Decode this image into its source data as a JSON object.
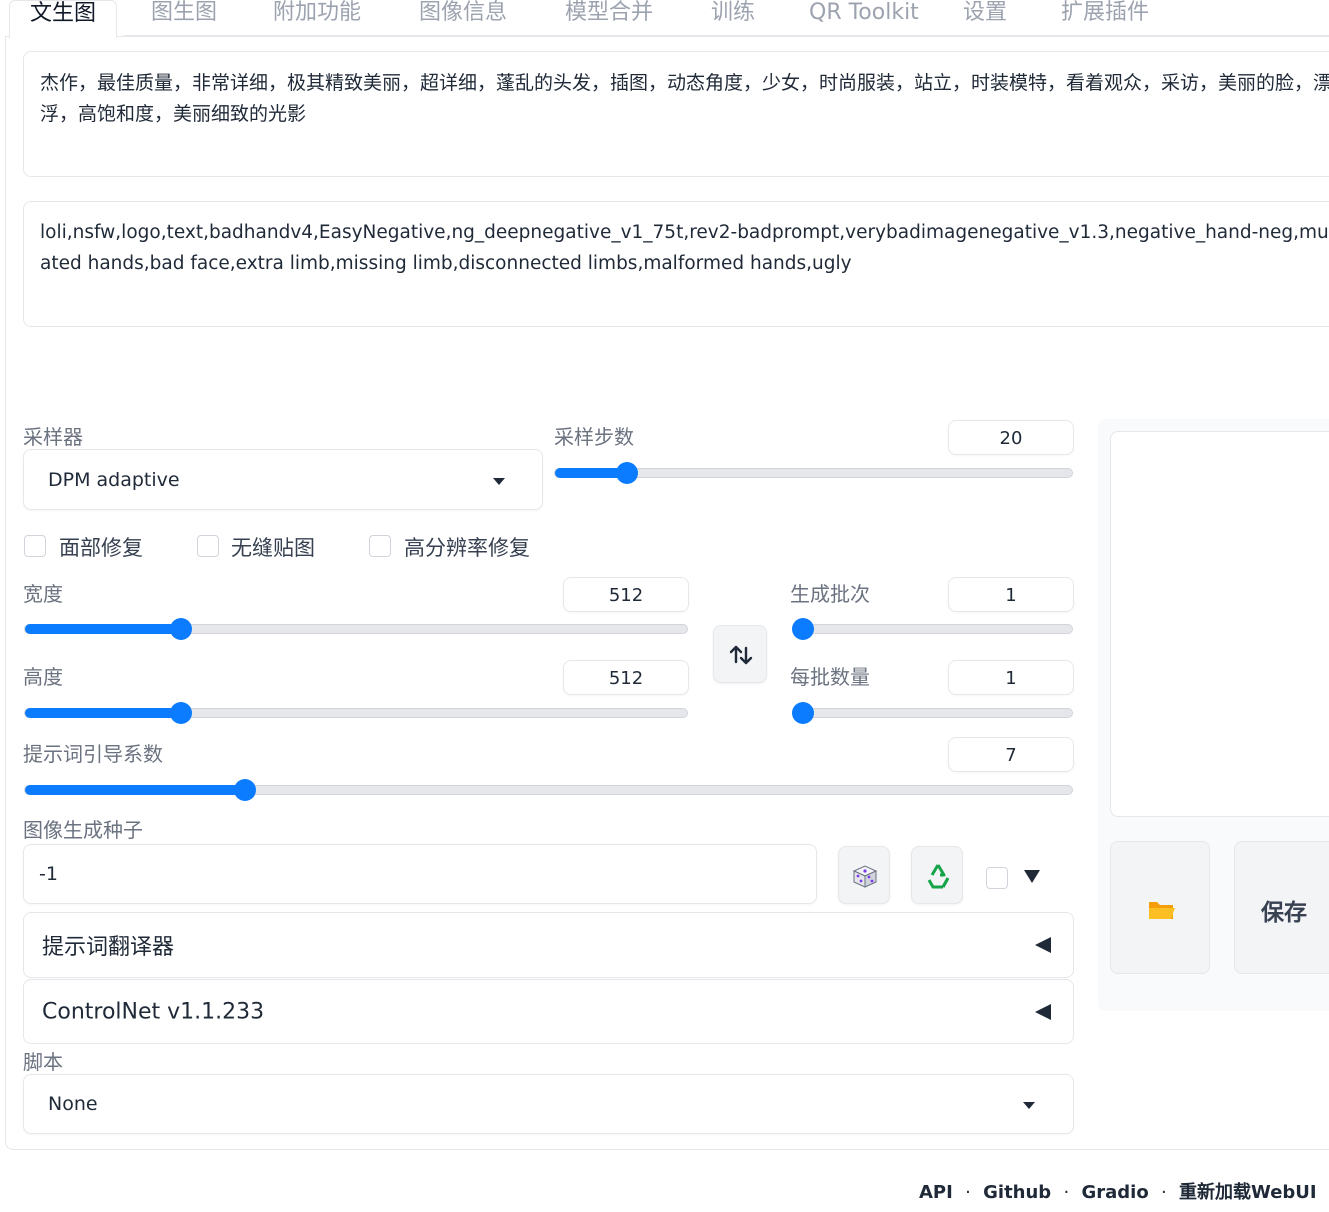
{
  "tabs": [
    {
      "label": "文生图",
      "active": true
    },
    {
      "label": "图生图"
    },
    {
      "label": "附加功能"
    },
    {
      "label": "图像信息"
    },
    {
      "label": "模型合并"
    },
    {
      "label": "训练"
    },
    {
      "label": "QR Toolkit"
    },
    {
      "label": "设置"
    },
    {
      "label": "扩展插件"
    }
  ],
  "prompt": {
    "text": "杰作，最佳质量，非常详细，极其精致美丽，超详细，蓬乱的头发，插图，动态角度，少女，时尚服装，站立，时装模特，看着观众，采访，美丽的脸，漂浮，高饱和度，美丽细致的光影"
  },
  "negative_prompt": {
    "text": "loli,nsfw,logo,text,badhandv4,EasyNegative,ng_deepnegative_v1_75t,rev2-badprompt,verybadimagenegative_v1.3,negative_hand-neg,mutated hands,bad face,extra limb,missing limb,disconnected limbs,malformed hands,ugly"
  },
  "sampler": {
    "label": "采样器",
    "value": "DPM adaptive"
  },
  "steps": {
    "label": "采样步数",
    "value": "20",
    "fraction": 0.14
  },
  "checkboxes": {
    "face_restore": "面部修复",
    "tiling": "无缝贴图",
    "hires_fix": "高分辨率修复"
  },
  "width": {
    "label": "宽度",
    "value": "512",
    "fraction": 0.235
  },
  "height": {
    "label": "高度",
    "value": "512",
    "fraction": 0.235
  },
  "batch_count": {
    "label": "生成批次",
    "value": "1",
    "fraction": 0.0
  },
  "batch_size": {
    "label": "每批数量",
    "value": "1",
    "fraction": 0.0
  },
  "cfg_scale": {
    "label": "提示词引导系数",
    "value": "7",
    "fraction": 0.21
  },
  "seed": {
    "label": "图像生成种子",
    "value": "-1"
  },
  "accordions": {
    "translator": "提示词翻译器",
    "controlnet": "ControlNet v1.1.233"
  },
  "script": {
    "label": "脚本",
    "value": "None"
  },
  "output": {
    "save_label": "保存"
  },
  "icons": {
    "swap": "swap-icon",
    "dice": "dice-icon",
    "recycle": "recycle-icon",
    "folder": "folder-icon"
  },
  "colors": {
    "accent": "#0b7cff"
  },
  "footer": {
    "api": "API",
    "sep": "·",
    "github": "Github",
    "gradio": "Gradio",
    "reload": "重新加载WebUI"
  }
}
